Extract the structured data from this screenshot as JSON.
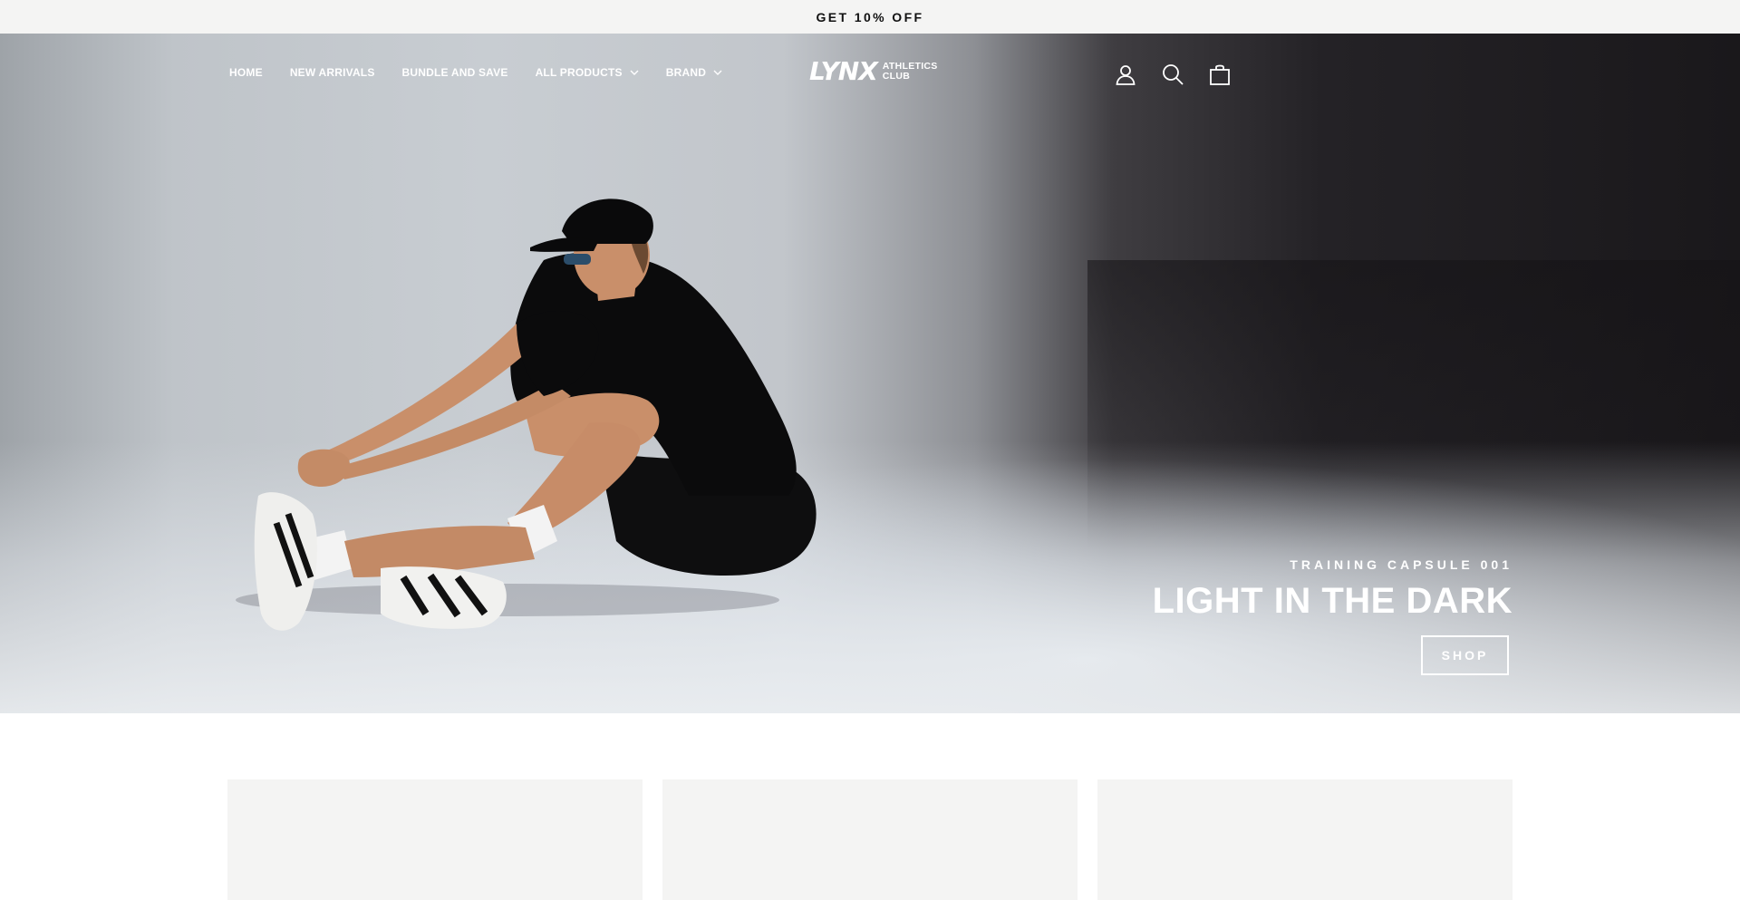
{
  "announcement": {
    "text": "GET 10% OFF"
  },
  "nav": {
    "links": [
      {
        "label": "HOME",
        "has_dropdown": false
      },
      {
        "label": "NEW ARRIVALS",
        "has_dropdown": false
      },
      {
        "label": "BUNDLE AND SAVE",
        "has_dropdown": false
      },
      {
        "label": "ALL PRODUCTS",
        "has_dropdown": true
      },
      {
        "label": "BRAND",
        "has_dropdown": true
      }
    ],
    "logo": {
      "mark": "LYNX",
      "line1": "ATHLETICS",
      "line2": "CLUB"
    },
    "icons": [
      "account-icon",
      "search-icon",
      "cart-icon"
    ]
  },
  "hero": {
    "eyebrow": "TRAINING CAPSULE 001",
    "title": "LIGHT IN THE DARK",
    "button_label": "SHOP"
  },
  "colors": {
    "announcement_bg": "#f4f4f3",
    "card_bg": "#f4f4f3",
    "text_on_hero": "#ffffff"
  }
}
